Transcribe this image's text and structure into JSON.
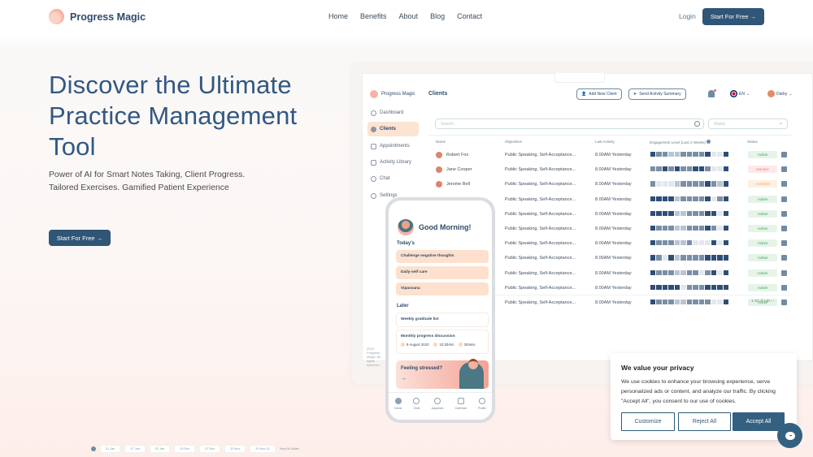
{
  "nav": {
    "brand": "Progress Magic",
    "links": [
      "Home",
      "Benefits",
      "About",
      "Blog",
      "Contact"
    ],
    "login": "Login",
    "cta": "Start For Free →"
  },
  "hero": {
    "title": "Discover the Ultimate Practice Management Tool",
    "subtitle": "Power of AI for Smart Notes Taking, Client Progress. Tailored Exercises. Gamified Patient Experience",
    "cta": "Start For Free →"
  },
  "dashboard": {
    "brand": "Progress Magic",
    "sidebar": [
      {
        "label": "Dashboard",
        "icon": "dashboard-icon",
        "active": false
      },
      {
        "label": "Clients",
        "icon": "clients-icon",
        "active": true
      },
      {
        "label": "Appointments",
        "icon": "calendar-icon",
        "active": false
      },
      {
        "label": "Activity Library",
        "icon": "folder-icon",
        "active": false
      },
      {
        "label": "Chat",
        "icon": "chat-icon",
        "active": false
      },
      {
        "label": "Settings",
        "icon": "gear-icon",
        "active": false
      }
    ],
    "footer": "2024 Progress Magic. All rights reserved",
    "page_title": "Clients",
    "add_client": "Add New Client",
    "send_summary": "Send Activity Summary",
    "language": "EN",
    "user": "Darby",
    "search_placeholder": "Search...",
    "status_placeholder": "Status",
    "columns": [
      "Name",
      "Objectives",
      "Last Activity",
      "Engagement Level (Last 2 Weeks)",
      "Status"
    ],
    "rows": [
      {
        "name": "Robert Fox",
        "objectives": "Public Speaking, Self-Acceptance...",
        "last": "8.00AM Yesterday",
        "status": "Active",
        "eng": [
          3,
          2,
          2,
          1,
          1,
          2,
          2,
          2,
          2,
          3,
          0,
          0,
          3
        ]
      },
      {
        "name": "Jane Cooper",
        "objectives": "Public Speaking, Self-Acceptance...",
        "last": "8.00AM Yesterday",
        "status": "Inactive",
        "eng": [
          2,
          2,
          3,
          2,
          3,
          2,
          2,
          3,
          3,
          2,
          0,
          0,
          3
        ]
      },
      {
        "name": "Jerome Bell",
        "objectives": "Public Speaking, Self-Acceptance...",
        "last": "8.00AM Yesterday",
        "status": "Archived",
        "eng": [
          2,
          0,
          0,
          0,
          1,
          2,
          2,
          2,
          2,
          3,
          2,
          1,
          3
        ]
      },
      {
        "name": "",
        "objectives": "Public Speaking, Self-Acceptance...",
        "last": "8.00AM Yesterday",
        "status": "Active",
        "eng": [
          3,
          3,
          3,
          3,
          1,
          2,
          2,
          2,
          2,
          3,
          0,
          2,
          3
        ]
      },
      {
        "name": "",
        "objectives": "Public Speaking, Self-Acceptance...",
        "last": "8.00AM Yesterday",
        "status": "Active",
        "eng": [
          3,
          3,
          3,
          3,
          1,
          1,
          2,
          2,
          2,
          3,
          3,
          0,
          3
        ]
      },
      {
        "name": "",
        "objectives": "Public Speaking, Self-Acceptance...",
        "last": "8.00AM Yesterday",
        "status": "Active",
        "eng": [
          3,
          2,
          2,
          2,
          1,
          1,
          2,
          2,
          2,
          3,
          2,
          0,
          3
        ]
      },
      {
        "name": "",
        "objectives": "Public Speaking, Self-Acceptance...",
        "last": "8.00AM Yesterday",
        "status": "Active",
        "eng": [
          3,
          2,
          2,
          2,
          1,
          1,
          2,
          0,
          0,
          0,
          3,
          0,
          3
        ]
      },
      {
        "name": "",
        "objectives": "Public Speaking, Self-Acceptance...",
        "last": "8.00AM Yesterday",
        "status": "Active",
        "eng": [
          3,
          2,
          0,
          3,
          1,
          2,
          2,
          2,
          2,
          3,
          3,
          3,
          3
        ]
      },
      {
        "name": "",
        "objectives": "Public Speaking, Self-Acceptance...",
        "last": "8.00AM Yesterday",
        "status": "Active",
        "eng": [
          3,
          2,
          2,
          2,
          1,
          1,
          2,
          2,
          0,
          2,
          3,
          0,
          3
        ]
      },
      {
        "name": "",
        "objectives": "Public Speaking, Self-Acceptance...",
        "last": "8.00AM Yesterday",
        "status": "Active",
        "eng": [
          3,
          3,
          3,
          3,
          3,
          0,
          2,
          2,
          2,
          3,
          3,
          3,
          3
        ]
      },
      {
        "name": "",
        "objectives": "Public Speaking, Self-Acceptance...",
        "last": "8.00AM Yesterday",
        "status": "Active",
        "eng": [
          3,
          2,
          2,
          2,
          1,
          1,
          2,
          2,
          2,
          2,
          0,
          0,
          3
        ]
      }
    ],
    "pager": "1-10 of 140",
    "eng_colors": [
      "#e3e8ee",
      "#b9c5d2",
      "#7b8ea6",
      "#2f4e75"
    ]
  },
  "phone": {
    "greeting": "Good Morning!",
    "today_label": "Today's",
    "today": [
      "Challenge negative thoughts",
      "Daily-self care",
      "Vipassana"
    ],
    "later_label": "Later",
    "later_1": "Weekly gratitude list",
    "later_2": "Monthly progress discussion",
    "later_2_date": "9 August 2023",
    "later_2_time": "10:30AM",
    "later_2_duration": "30mins",
    "stress": "Feeling stressed?",
    "stress_arrow": "→",
    "tabs": [
      "Home",
      "Chat",
      "Aquarium",
      "Calendar",
      "Profile"
    ]
  },
  "strip": {
    "dates": [
      "31 Jan",
      "07 Jan",
      "02 Jan",
      "20 Dec",
      "07 Dec",
      "20 Nov",
      "20 Nov 22"
    ],
    "view_all": "View All Notes"
  },
  "cookie": {
    "title": "We value your privacy",
    "body": "We use cookies to enhance your browsing experience, serve personalized ads or content, and analyze our traffic. By clicking \"Accept All\", you consent to our use of cookies.",
    "customize": "Customize",
    "reject": "Reject All",
    "accept": "Accept All"
  }
}
